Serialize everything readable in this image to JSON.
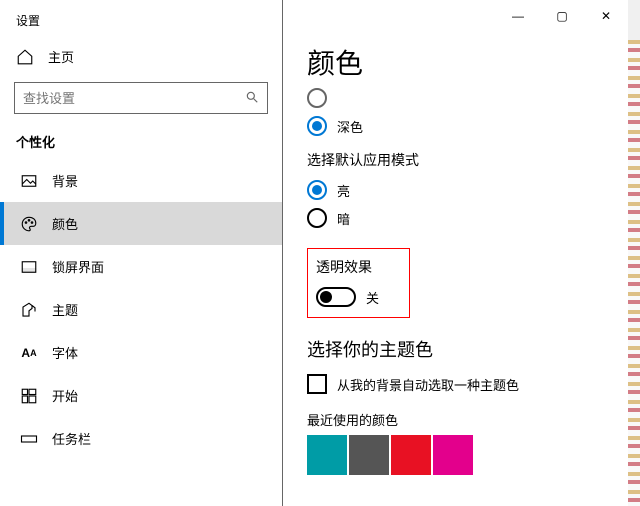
{
  "window_title": "设置",
  "titlebar": {
    "min": "—",
    "max": "▢",
    "close": "✕"
  },
  "sidebar": {
    "home_label": "主页",
    "search_placeholder": "查找设置",
    "section_label": "个性化",
    "items": [
      {
        "label": "背景"
      },
      {
        "label": "颜色"
      },
      {
        "label": "锁屏界面"
      },
      {
        "label": "主题"
      },
      {
        "label": "字体"
      },
      {
        "label": "开始"
      },
      {
        "label": "任务栏"
      }
    ]
  },
  "content": {
    "title": "颜色",
    "windows_mode": {
      "option_dark": "深色"
    },
    "app_mode": {
      "label": "选择默认应用模式",
      "option_light": "亮",
      "option_dark": "暗"
    },
    "transparency": {
      "label": "透明效果",
      "state_text": "关"
    },
    "accent": {
      "heading": "选择你的主题色",
      "auto_pick_label": "从我的背景自动选取一种主题色",
      "recent_label": "最近使用的颜色",
      "swatches": [
        "#009ca6",
        "#555555",
        "#e81123",
        "#e3008c"
      ]
    }
  }
}
